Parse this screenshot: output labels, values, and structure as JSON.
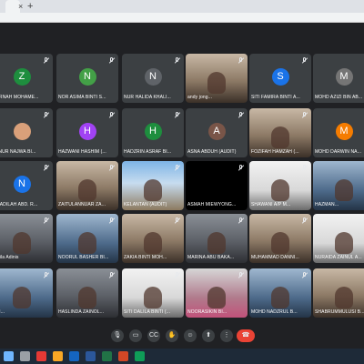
{
  "browser": {
    "close_glyph": "×",
    "new_tab_glyph": "+"
  },
  "participants": [
    {
      "name": "BARNAH MOHAME...",
      "initial": "Z",
      "color": "#1e8e3e",
      "video": null
    },
    {
      "name": "NOR ASIMA BINTI S...",
      "initial": "N",
      "color": "#43a047",
      "video": null
    },
    {
      "name": "NUR HALIDA KHALI...",
      "initial": "N",
      "color": "#5f6368",
      "video": null
    },
    {
      "name": "andy jong...",
      "initial": "",
      "color": "",
      "video": "warm"
    },
    {
      "name": "SITI FAMIRA BINTI A...",
      "initial": "S",
      "color": "#1a73e8",
      "video": null
    },
    {
      "name": "MOHD AZIZI BIN AB...",
      "initial": "M",
      "color": "#757575",
      "video": null
    },
    {
      "name": "IK NUR NAJWA BI...",
      "initial": "",
      "color": "",
      "video": "avatar"
    },
    {
      "name": "HAZWANI HASHIM (...",
      "initial": "H",
      "color": "#a142f4",
      "video": null
    },
    {
      "name": "HADZRIN ASRAF BI...",
      "initial": "H",
      "color": "#1e8e3e",
      "video": null
    },
    {
      "name": "ASNA ABDUH (AUDIT)",
      "initial": "A",
      "color": "#795548",
      "video": null
    },
    {
      "name": "FOZIFAH HAMZAH (...",
      "initial": "",
      "color": "",
      "video": "warm"
    },
    {
      "name": "MOHD DARWIN NA...",
      "initial": "M",
      "color": "#f57c00",
      "video": null
    },
    {
      "name": "ORADILAH ABD. R...",
      "initial": "N",
      "color": "#1a73e8",
      "video": null
    },
    {
      "name": "ZAITULANNUAR ZA...",
      "initial": "",
      "color": "",
      "video": "warm"
    },
    {
      "name": "KELANTAN (AUDIT)",
      "initial": "",
      "color": "",
      "video": "sky"
    },
    {
      "name": "ASMAH MIEWYONG...",
      "initial": "",
      "color": "",
      "video": "black"
    },
    {
      "name": "SHAWANI A/P M...",
      "initial": "",
      "color": "",
      "video": "white"
    },
    {
      "name": "HAZMAN...",
      "initial": "",
      "color": "",
      "video": "blue"
    },
    {
      "name": "Dalila Adinis",
      "initial": "",
      "color": "",
      "video": "gray"
    },
    {
      "name": "NOORUL BASHER BI...",
      "initial": "",
      "color": "",
      "video": "blue"
    },
    {
      "name": "ZAKIA BINTI MOH...",
      "initial": "",
      "color": "",
      "video": "warm"
    },
    {
      "name": "MARINA ABU BAKA...",
      "initial": "",
      "color": "",
      "video": "gray"
    },
    {
      "name": "MUHAMMAD DANNI...",
      "initial": "",
      "color": "",
      "video": "warm"
    },
    {
      "name": "NURAIDA ZAINUL A...",
      "initial": "",
      "color": "",
      "video": "white"
    },
    {
      "name": "SIN...",
      "initial": "",
      "color": "",
      "video": "blue"
    },
    {
      "name": "HASLINDA ZAINOL...",
      "initial": "",
      "color": "",
      "video": "gray"
    },
    {
      "name": "SITI DALILA BINTI (...",
      "initial": "",
      "color": "",
      "video": "white"
    },
    {
      "name": "NOORASIKIN BI...",
      "initial": "",
      "color": "",
      "video": "pink"
    },
    {
      "name": "MOHD NADZRUL B...",
      "initial": "",
      "color": "",
      "video": "blue"
    },
    {
      "name": "SHABRUMMULUSI B...",
      "initial": "",
      "color": "",
      "video": "warm"
    }
  ],
  "controls": [
    {
      "name": "mic-button",
      "glyph": "🎙"
    },
    {
      "name": "camera-button",
      "glyph": "▭"
    },
    {
      "name": "captions-button",
      "glyph": "CC"
    },
    {
      "name": "raise-hand-button",
      "glyph": "✋"
    },
    {
      "name": "emoji-button",
      "glyph": "☺"
    },
    {
      "name": "present-button",
      "glyph": "⬆"
    },
    {
      "name": "more-options-button",
      "glyph": "⋮"
    },
    {
      "name": "end-call-button",
      "glyph": "☎"
    }
  ],
  "taskbar": {
    "icons": [
      {
        "name": "windows-start-icon",
        "color": "#6fb6ff"
      },
      {
        "name": "search-icon",
        "color": "#9aa0a6"
      },
      {
        "name": "chrome-icon",
        "color": "#e53935"
      },
      {
        "name": "file-explorer-icon",
        "color": "#f9a825"
      },
      {
        "name": "outlook-icon",
        "color": "#1565c0"
      },
      {
        "name": "word-icon",
        "color": "#2b579a"
      },
      {
        "name": "excel-icon",
        "color": "#217346"
      },
      {
        "name": "powerpoint-icon",
        "color": "#d24726"
      },
      {
        "name": "edge-icon",
        "color": "#0f9d58"
      }
    ]
  }
}
